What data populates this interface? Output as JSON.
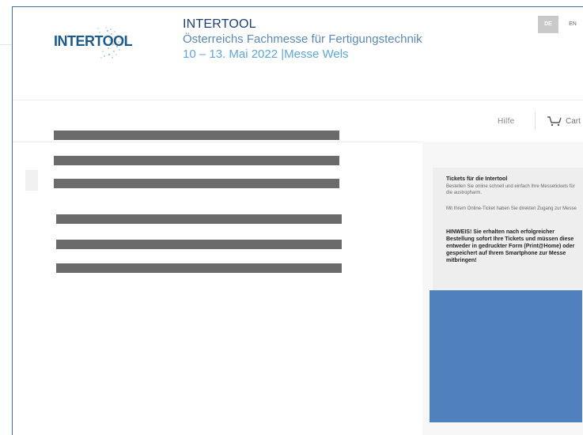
{
  "header": {
    "logo_text": "INTERTOOL",
    "title": "INTERTOOL",
    "subtitle": "Österreichs Fachmesse für Fertigungstechnik",
    "date_line": "10 – 13. Mai 2022 |Messe Wels",
    "languages": [
      {
        "code": "DE",
        "active": true
      },
      {
        "code": "EN",
        "active": false
      }
    ]
  },
  "nav": {
    "help_label": "Hilfe",
    "cart_label": "Cart"
  },
  "info_box": {
    "title": "Tickets für die Intertool",
    "paragraph1": "Bestellen Sie online schnell und einfach Ihre Messetickets für die austropharm.",
    "paragraph2": "Mit Ihrem Online-Ticket haben Sie direkten Zugang zur Messe",
    "notice": "HINWEIS! Sie erhalten nach erfolgreicher Bestellung sofort Ihre Tickets und müssen diese entweder in gedruckter Form (Print@Home) oder gespeichert auf Ihrem Smartphone zur Messe mitbringen!"
  },
  "colors": {
    "frame_border": "#3a6ea5",
    "brand_dark": "#1d3f73",
    "brand_mid": "#5b89b3",
    "brand_light": "#5ea6d6",
    "redaction": "#6b6b6b",
    "blue_block": "#5080bd"
  }
}
